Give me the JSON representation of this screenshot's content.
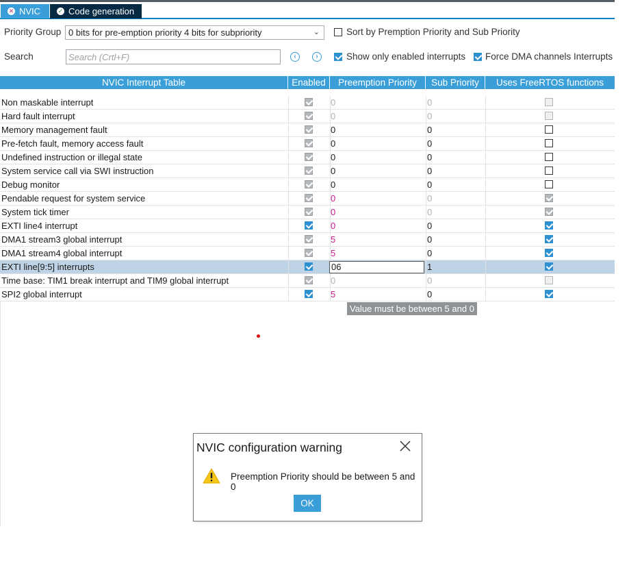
{
  "tabs": [
    {
      "label": "NVIC",
      "icon": "error-circle-icon"
    },
    {
      "label": "Code generation",
      "icon": "check-circle-icon"
    }
  ],
  "toolbar": {
    "priority_group_label": "Priority Group",
    "priority_group_value": "0 bits for pre-emption priority 4 bits for subpriority",
    "sort_label": "Sort by Premption Priority and Sub Priority",
    "sort_checked": false,
    "search_label": "Search",
    "search_placeholder": "Search (Crtl+F)",
    "show_enabled_label": "Show only enabled interrupts",
    "show_enabled_checked": true,
    "force_dma_label": "Force DMA channels Interrupts",
    "force_dma_checked": true
  },
  "table": {
    "columns": [
      "NVIC Interrupt Table",
      "Enabled",
      "Preemption Priority",
      "Sub Priority",
      "Uses FreeRTOS functions"
    ],
    "rows": [
      {
        "name": "Non maskable interrupt",
        "enabled": "disabled-checked",
        "pre": "0",
        "pre_style": "gray",
        "sub": "0",
        "sub_style": "gray",
        "freertos": "disabled-unchecked"
      },
      {
        "name": "Hard fault interrupt",
        "enabled": "disabled-checked",
        "pre": "0",
        "pre_style": "gray",
        "sub": "0",
        "sub_style": "gray",
        "freertos": "disabled-unchecked"
      },
      {
        "name": "Memory management fault",
        "enabled": "disabled-checked",
        "pre": "0",
        "pre_style": "black",
        "sub": "0",
        "sub_style": "black",
        "freertos": "unchecked"
      },
      {
        "name": "Pre-fetch fault, memory access fault",
        "enabled": "disabled-checked",
        "pre": "0",
        "pre_style": "black",
        "sub": "0",
        "sub_style": "black",
        "freertos": "unchecked"
      },
      {
        "name": "Undefined instruction or illegal state",
        "enabled": "disabled-checked",
        "pre": "0",
        "pre_style": "black",
        "sub": "0",
        "sub_style": "black",
        "freertos": "unchecked"
      },
      {
        "name": "System service call via SWI instruction",
        "enabled": "disabled-checked",
        "pre": "0",
        "pre_style": "black",
        "sub": "0",
        "sub_style": "black",
        "freertos": "unchecked"
      },
      {
        "name": "Debug monitor",
        "enabled": "disabled-checked",
        "pre": "0",
        "pre_style": "black",
        "sub": "0",
        "sub_style": "black",
        "freertos": "unchecked"
      },
      {
        "name": "Pendable request for system service",
        "enabled": "disabled-checked",
        "pre": "0",
        "pre_style": "pink",
        "sub": "0",
        "sub_style": "gray",
        "freertos": "disabled-checked"
      },
      {
        "name": "System tick timer",
        "enabled": "disabled-checked",
        "pre": "0",
        "pre_style": "pink",
        "sub": "0",
        "sub_style": "gray",
        "freertos": "disabled-checked"
      },
      {
        "name": "EXTI line4 interrupt",
        "enabled": "checked",
        "pre": "0",
        "pre_style": "pink",
        "sub": "0",
        "sub_style": "black",
        "freertos": "checked"
      },
      {
        "name": "DMA1 stream3 global interrupt",
        "enabled": "disabled-checked",
        "pre": "5",
        "pre_style": "pink",
        "sub": "0",
        "sub_style": "black",
        "freertos": "checked"
      },
      {
        "name": "DMA1 stream4 global interrupt",
        "enabled": "disabled-checked",
        "pre": "5",
        "pre_style": "pink",
        "sub": "0",
        "sub_style": "black",
        "freertos": "checked"
      },
      {
        "name": "EXTI line[9:5] interrupts",
        "enabled": "checked",
        "pre": "06",
        "pre_style": "edit",
        "sub": "1",
        "sub_style": "black",
        "freertos": "checked",
        "selected": true
      },
      {
        "name": "Time base: TIM1 break interrupt and TIM9 global interrupt",
        "enabled": "disabled-checked",
        "pre": "0",
        "pre_style": "gray",
        "sub": "0",
        "sub_style": "gray",
        "freertos": "disabled-unchecked"
      },
      {
        "name": "SPI2 global interrupt",
        "enabled": "checked",
        "pre": "5",
        "pre_style": "pink",
        "sub": "0",
        "sub_style": "black",
        "freertos": "checked"
      }
    ]
  },
  "tooltip": {
    "text": "Value must be between 5 and 0"
  },
  "dialog": {
    "title": "NVIC configuration warning",
    "message": "Preemption Priority should be between 5 and 0",
    "ok_label": "OK",
    "icon": "warning-icon",
    "close_icon": "close-icon"
  },
  "colors": {
    "accent": "#3a9fd9",
    "dark_tab": "#062944",
    "priority_pink": "#c61a8a",
    "selected_row": "#bfd3e6",
    "tooltip_bg": "#8f9396"
  }
}
